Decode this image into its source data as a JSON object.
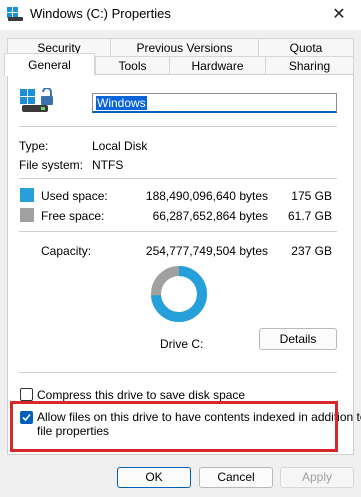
{
  "window": {
    "title": "Windows (C:) Properties",
    "close_icon": "close-icon"
  },
  "tabs": {
    "row1": [
      "Security",
      "Previous Versions",
      "Quota"
    ],
    "row2": [
      "General",
      "Tools",
      "Hardware",
      "Sharing"
    ],
    "active": "General"
  },
  "general": {
    "drive_name": "Windows",
    "type_label": "Type:",
    "type_value": "Local Disk",
    "fs_label": "File system:",
    "fs_value": "NTFS",
    "used": {
      "label": "Used space:",
      "bytes": "188,490,096,640 bytes",
      "size": "175 GB",
      "color": "#26a0da"
    },
    "free": {
      "label": "Free space:",
      "bytes": "66,287,652,864 bytes",
      "size": "61.7 GB",
      "color": "#a0a0a0"
    },
    "capacity": {
      "label": "Capacity:",
      "bytes": "254,777,749,504 bytes",
      "size": "237 GB"
    },
    "used_fraction": 0.74,
    "drive_caption": "Drive C:",
    "details_button": "Details",
    "compress_label": "Compress this drive to save disk space",
    "compress_checked": false,
    "index_label_line1": "Allow files on this drive to have contents indexed in addition to",
    "index_label_line2": "file properties",
    "index_checked": true
  },
  "buttons": {
    "ok": "OK",
    "cancel": "Cancel",
    "apply": "Apply"
  },
  "colors": {
    "accent": "#005fb8",
    "highlight": "#d8262d"
  }
}
